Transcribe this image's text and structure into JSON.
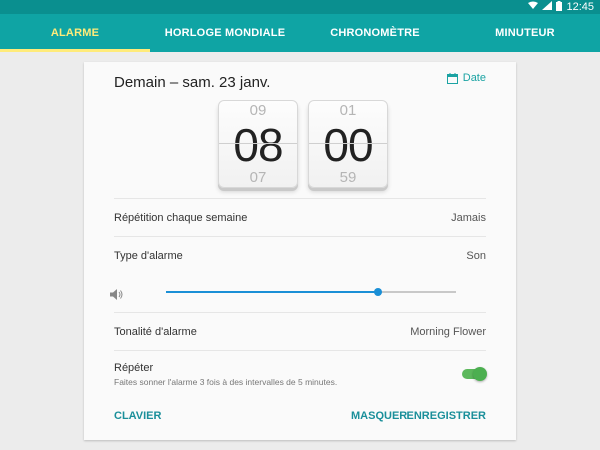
{
  "status_bar": {
    "time": "12:45"
  },
  "tabs": [
    {
      "label": "ALARME",
      "active": true
    },
    {
      "label": "HORLOGE MONDIALE",
      "active": false
    },
    {
      "label": "CHRONOMÈTRE",
      "active": false
    },
    {
      "label": "MINUTEUR",
      "active": false
    }
  ],
  "alarm": {
    "date_title": "Demain – sam. 23 janv.",
    "date_button": "Date",
    "hours": {
      "prev": "09",
      "current": "08",
      "next": "07"
    },
    "minutes": {
      "prev": "01",
      "current": "00",
      "next": "59"
    },
    "repeat_weekly": {
      "label": "Répétition chaque semaine",
      "value": "Jamais"
    },
    "alarm_type": {
      "label": "Type d'alarme",
      "value": "Son"
    },
    "volume": {
      "level": 0.73
    },
    "ringtone": {
      "label": "Tonalité d'alarme",
      "value": "Morning Flower"
    },
    "snooze": {
      "label": "Répéter",
      "description": "Faites sonner l'alarme 3 fois à des intervalles de 5 minutes.",
      "enabled": true
    }
  },
  "actions": {
    "keyboard": "CLAVIER",
    "hide": "MASQUER",
    "save": "ENREGISTRER"
  },
  "colors": {
    "accent": "#0fa4a4",
    "active_tab": "#ffeb7a",
    "slider": "#1a8fd6",
    "toggle": "#4caf50"
  },
  "icons": [
    "wifi-icon",
    "signal-icon",
    "battery-icon",
    "calendar-icon",
    "volume-icon"
  ]
}
